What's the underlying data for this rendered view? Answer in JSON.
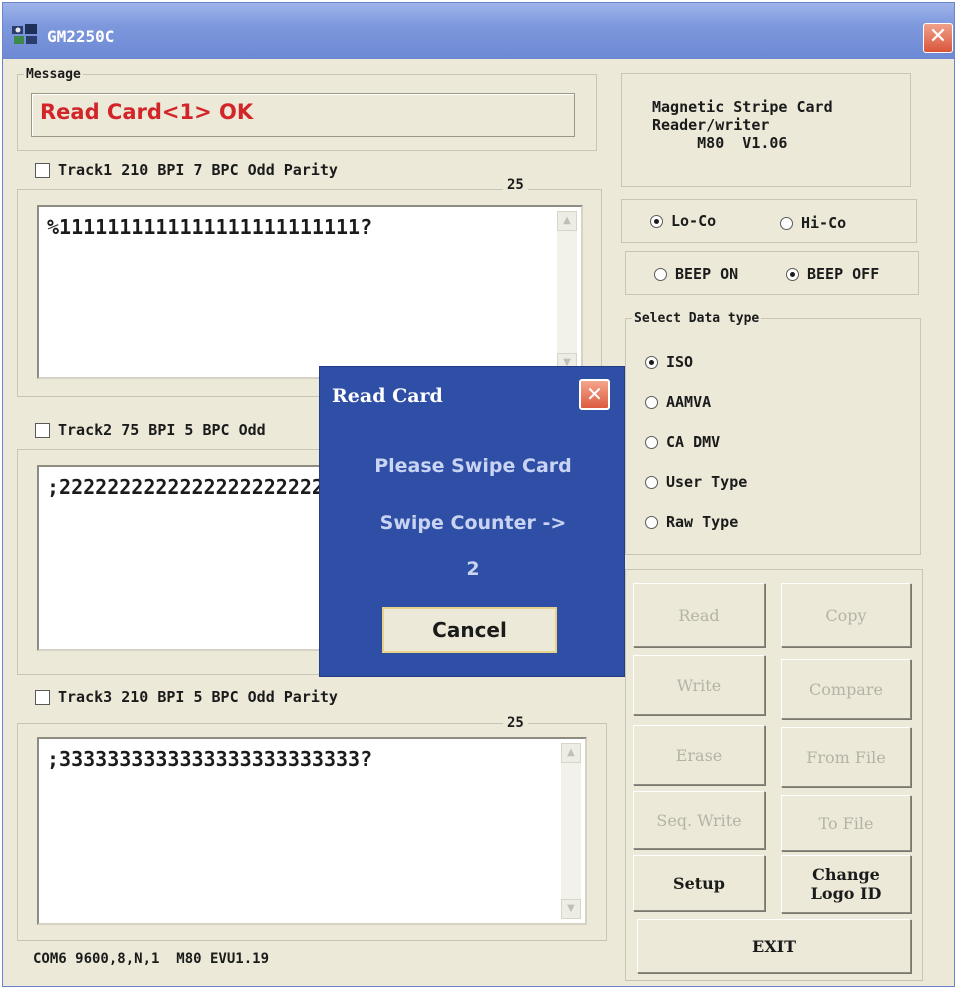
{
  "window": {
    "title": "GM2250C",
    "close_label": "✕"
  },
  "message": {
    "legend": "Message",
    "text": "Read Card<1> OK"
  },
  "track1": {
    "label": "Track1 210 BPI 7 BPC Odd Parity",
    "count": "25",
    "data": "%1111111111111111111111111?",
    "checked": false
  },
  "track2": {
    "label": "Track2 75 BPI 5 BPC Odd",
    "data": ";2222222222222222222222",
    "checked": false
  },
  "track3": {
    "label": "Track3 210 BPI 5 BPC Odd Parity",
    "count": "25",
    "data": ";3333333333333333333333333?",
    "checked": false
  },
  "device_info": {
    "text": "Magnetic Stripe Card\nReader/writer\n     M80  V1.06"
  },
  "coercivity": {
    "lo_label": "Lo-Co",
    "hi_label": "Hi-Co",
    "selected": "lo"
  },
  "beep": {
    "on_label": "BEEP ON",
    "off_label": "BEEP OFF",
    "selected": "off"
  },
  "data_type": {
    "legend": "Select Data type",
    "options": [
      "ISO",
      "AAMVA",
      "CA DMV",
      "User Type",
      "Raw Type"
    ],
    "selected": "ISO"
  },
  "buttons": {
    "read": "Read",
    "copy": "Copy",
    "write": "Write",
    "compare": "Compare",
    "erase": "Erase",
    "from_file": "From File",
    "seq_write": "Seq. Write",
    "to_file": "To File",
    "setup": "Setup",
    "change_logo_1": "Change",
    "change_logo_2": "Logo ID",
    "exit": "EXIT"
  },
  "status": {
    "text": "COM6 9600,8,N,1  M80 EVU1.19"
  },
  "dialog": {
    "title": "Read Card",
    "close_label": "✕",
    "prompt": "Please Swipe Card",
    "counter_label": "Swipe Counter  ->",
    "counter_value": "2",
    "cancel_label": "Cancel"
  },
  "colors": {
    "message_text": "#d2252a",
    "dialog_bg": "#2f4fa6",
    "titlebar": "#7d98dc"
  },
  "icons": {
    "app": "card-reader-icon",
    "scroll_up": "chevron-up-icon",
    "scroll_down": "chevron-down-icon"
  }
}
